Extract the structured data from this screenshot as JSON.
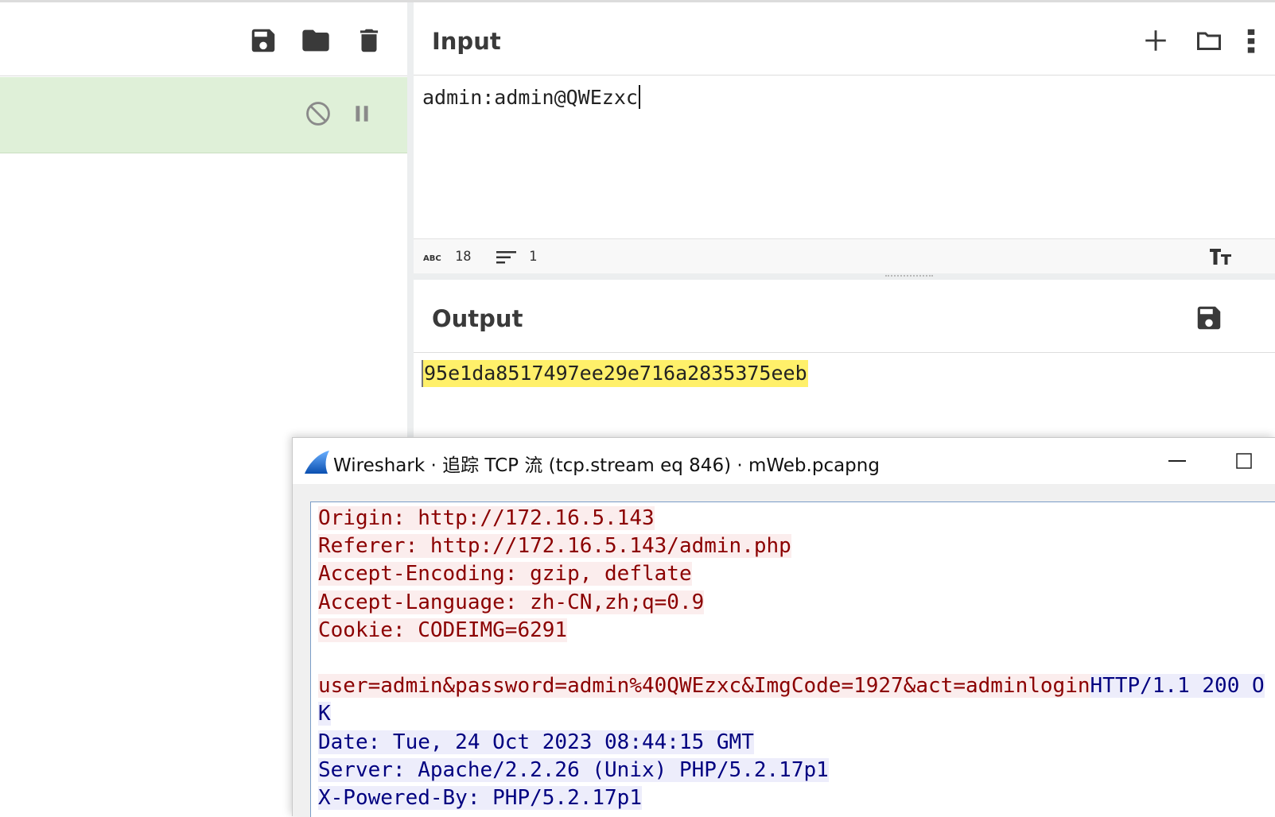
{
  "recipe": {
    "toolbar_icons": [
      "save-icon",
      "folder-icon",
      "trash-icon"
    ],
    "operation_icons": [
      "disable-icon",
      "pause-icon"
    ],
    "operation_color": "#dff0d8"
  },
  "input": {
    "title": "Input",
    "value": "admin:admin@QWEzxc",
    "stats": {
      "length": "18",
      "lines": "1"
    }
  },
  "output": {
    "title": "Output",
    "value": "95e1da8517497ee29e716a2835375eeb",
    "highlight_color": "#fff06a"
  },
  "wireshark": {
    "title": "Wireshark · 追踪 TCP 流 (tcp.stream eq 846) · mWeb.pcapng",
    "stream_lines": [
      {
        "text": "Origin: http://172.16.5.143",
        "dir": "req"
      },
      {
        "text": "Referer: http://172.16.5.143/admin.php",
        "dir": "req"
      },
      {
        "text": "Accept-Encoding: gzip, deflate",
        "dir": "req"
      },
      {
        "text": "Accept-Language: zh-CN,zh;q=0.9",
        "dir": "req"
      },
      {
        "text": "Cookie: CODEIMG=6291",
        "dir": "req"
      },
      {
        "text": "",
        "dir": "req"
      },
      {
        "text": "user=admin&password=admin%40QWEzxc&ImgCode=1927&act=adminlogin",
        "dir": "req",
        "tail": "HTTP/1.1 200 O"
      },
      {
        "text": "K",
        "dir": "resp"
      },
      {
        "text": "Date: Tue, 24 Oct 2023 08:44:15 GMT",
        "dir": "resp"
      },
      {
        "text": "Server: Apache/2.2.26 (Unix) PHP/5.2.17p1",
        "dir": "resp"
      },
      {
        "text": "X-Powered-By: PHP/5.2.17p1",
        "dir": "resp"
      }
    ],
    "colors": {
      "request": "#8b0000",
      "response": "#000080"
    }
  }
}
